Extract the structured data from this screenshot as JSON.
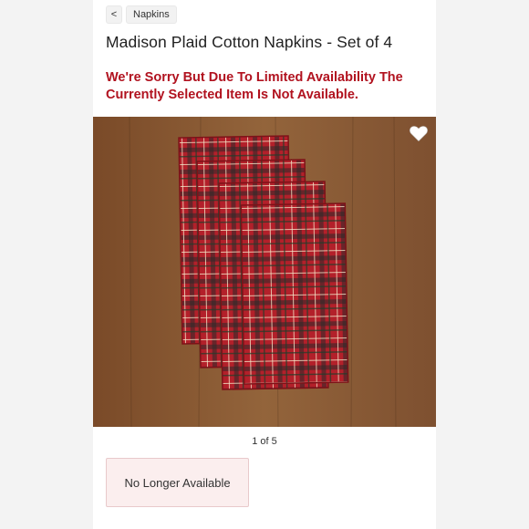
{
  "breadcrumb": {
    "back_label": "<",
    "category_label": "Napkins"
  },
  "product": {
    "title": "Madison Plaid Cotton Napkins - Set of 4"
  },
  "availability_notice": "We're Sorry But Due To Limited Availability The Currently Selected Item Is Not Available.",
  "gallery": {
    "image_description": "Four red tartan plaid napkins folded on a wooden table",
    "counter": "1 of 5",
    "favorite_icon": "heart-icon"
  },
  "status_box": {
    "label": "No Longer Available"
  },
  "colors": {
    "notice_red": "#b1121f",
    "plaid_red": "#b3202a",
    "wood": "#8a5a33",
    "status_bg": "#fbeeee"
  }
}
